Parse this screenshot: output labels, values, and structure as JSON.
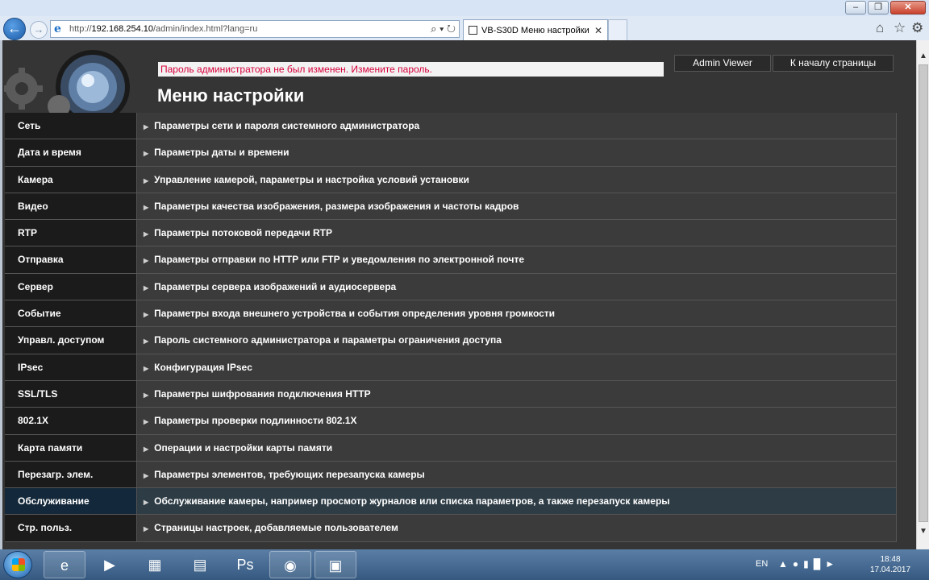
{
  "window": {
    "minimize": "–",
    "maximize": "❐",
    "close": "✕"
  },
  "browser": {
    "url_prefix": "http://",
    "url_host": "192.168.254.10",
    "url_path": "/admin/index.html?lang=ru",
    "search_tools": "⌕ ▾ ↻",
    "tab_title": "VB-S30D Меню настройки",
    "tab_close": "✕"
  },
  "header": {
    "warning": "Пароль администратора не был изменен. Измените пароль.",
    "title": "Меню настройки",
    "admin_viewer": "Admin Viewer",
    "home_link": "К началу страницы"
  },
  "menu": [
    {
      "name": "Сеть",
      "desc": "Параметры сети и пароля системного администратора"
    },
    {
      "name": "Дата и время",
      "desc": "Параметры даты и времени"
    },
    {
      "name": "Камера",
      "desc": "Управление камерой, параметры и настройка условий установки"
    },
    {
      "name": "Видео",
      "desc": "Параметры качества изображения, размера изображения и частоты кадров"
    },
    {
      "name": "RTP",
      "desc": "Параметры потоковой передачи RTP"
    },
    {
      "name": "Отправка",
      "desc": "Параметры отправки по HTTP или FTP и уведомления по электронной почте"
    },
    {
      "name": "Сервер",
      "desc": "Параметры сервера изображений и аудиосервера"
    },
    {
      "name": "Событие",
      "desc": "Параметры входа внешнего устройства и события определения уровня громкости"
    },
    {
      "name": "Управл. доступом",
      "desc": "Пароль системного администратора и параметры ограничения доступа"
    },
    {
      "name": "IPsec",
      "desc": "Конфигурация IPsec"
    },
    {
      "name": "SSL/TLS",
      "desc": "Параметры шифрования подключения HTTP"
    },
    {
      "name": "802.1X",
      "desc": "Параметры проверки подлинности 802.1X"
    },
    {
      "name": "Карта памяти",
      "desc": "Операции и настройки карты памяти"
    },
    {
      "name": "Перезагр. элем.",
      "desc": "Параметры элементов, требующих перезапуска камеры"
    },
    {
      "name": "Обслуживание",
      "desc": "Обслуживание камеры, например просмотр журналов или списка параметров, а также перезапуск камеры",
      "active": true
    },
    {
      "name": "Стр. польз.",
      "desc": "Страницы настроек, добавляемые пользователем"
    }
  ],
  "taskbar": {
    "lang": "EN",
    "time": "18:48",
    "date": "17.04.2017"
  }
}
